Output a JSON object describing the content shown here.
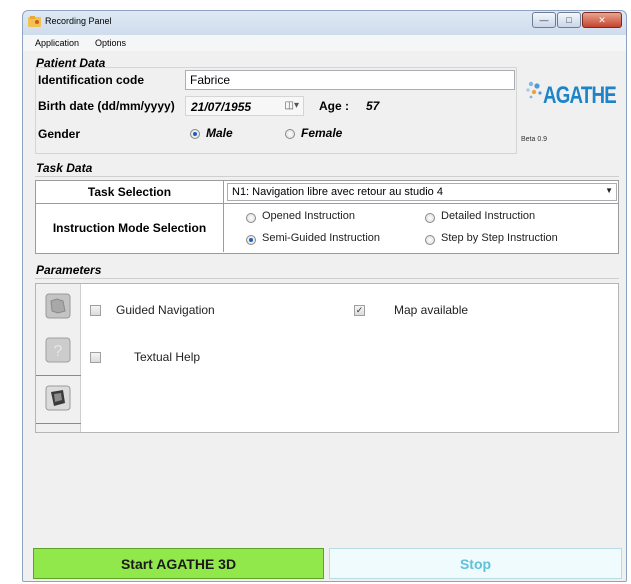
{
  "window": {
    "title": "Recording Panel"
  },
  "menu": [
    "Application",
    "Options"
  ],
  "patient": {
    "section": "Patient Data",
    "id_label": "Identification code",
    "id_value": "Fabrice",
    "birth_label": "Birth date (dd/mm/yyyy)",
    "birth_value": "21/07/1955",
    "age_label": "Age :",
    "age_value": "57",
    "gender_label": "Gender",
    "gender_male": "Male",
    "gender_female": "Female",
    "gender_selected": "Male"
  },
  "logo": {
    "text": "AGATHE",
    "version": "Beta 0.9"
  },
  "task": {
    "section": "Task Data",
    "selection_label": "Task Selection",
    "selection_value": "N1: Navigation libre avec retour au studio 4",
    "mode_label": "Instruction Mode Selection",
    "modes": [
      "Opened Instruction",
      "Detailed Instruction",
      "Semi-Guided Instruction",
      "Step by Step Instruction"
    ],
    "mode_selected": "Semi-Guided Instruction"
  },
  "parameters": {
    "section": "Parameters",
    "guided_navigation": "Guided Navigation",
    "guided_checked": false,
    "map_available": "Map available",
    "map_checked": true,
    "textual_help": "Textual Help",
    "textual_checked": false
  },
  "buttons": {
    "start": "Start AGATHE 3D",
    "stop": "Stop"
  },
  "colors": {
    "start_bg": "#90e84a",
    "stop_fg": "#5ec2d8",
    "logo": "#1d84c9"
  }
}
